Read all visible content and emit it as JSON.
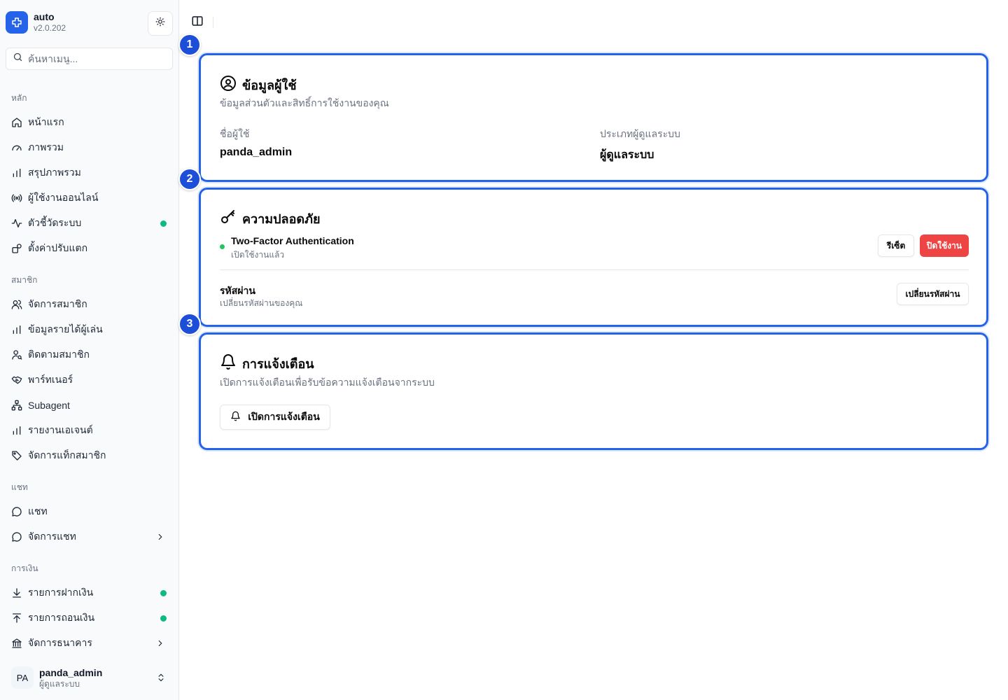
{
  "app": {
    "name": "auto",
    "version": "v2.0.202"
  },
  "search": {
    "placeholder": "ค้นหาเมนู..."
  },
  "sidebar": {
    "groups": {
      "main": "หลัก",
      "members": "สมาชิก",
      "chat": "แชท",
      "finance": "การเงิน"
    },
    "items": {
      "home": "หน้าแรก",
      "overview": "ภาพรวม",
      "summary": "สรุปภาพรวม",
      "online": "ผู้ใช้งานออนไลน์",
      "metrics": "ตัวชี้วัดระบบ",
      "settings": "ตั้งค่าปรับแตก",
      "manage_members": "จัดการสมาชิก",
      "player_income": "ข้อมูลรายได้ผู้เล่น",
      "track_members": "ติดตามสมาชิก",
      "partner": "พาร์ทเนอร์",
      "subagent": "Subagent",
      "agent_report": "รายงานเอเจนต์",
      "member_tags": "จัดการแท็กสมาชิก",
      "chat": "แชท",
      "manage_chat": "จัดการแชท",
      "deposits": "รายการฝากเงิน",
      "withdrawals": "รายการถอนเงิน",
      "banks": "จัดการธนาคาร"
    }
  },
  "user": {
    "initials": "PA",
    "name": "panda_admin",
    "role": "ผู้ดูแลระบบ"
  },
  "badges": [
    "1",
    "2",
    "3"
  ],
  "profile": {
    "title": "ข้อมูลผู้ใช้",
    "description": "ข้อมูลส่วนตัวและสิทธิ์การใช้งานของคุณ",
    "username_label": "ชื่อผู้ใช้",
    "username": "panda_admin",
    "role_label": "ประเภทผู้ดูแลระบบ",
    "role": "ผู้ดูแลระบบ"
  },
  "security": {
    "title": "ความปลอดภัย",
    "twofa_title": "Two-Factor Authentication",
    "twofa_status": "เปิดใช้งานแล้ว",
    "reset_label": "รีเซ็ต",
    "disable_label": "ปิดใช้งาน",
    "password_title": "รหัสผ่าน",
    "password_desc": "เปลี่ยนรหัสผ่านของคุณ",
    "change_password_label": "เปลี่ยนรหัสผ่าน"
  },
  "notifications": {
    "title": "การแจ้งเตือน",
    "description": "เปิดการแจ้งเตือนเพื่อรับข้อความแจ้งเตือนจากระบบ",
    "enable_label": "เปิดการแจ้งเตือน"
  },
  "colors": {
    "accent": "#2563eb",
    "badge": "#1d4ed8",
    "danger": "#ef4444",
    "online": "#10b981"
  }
}
